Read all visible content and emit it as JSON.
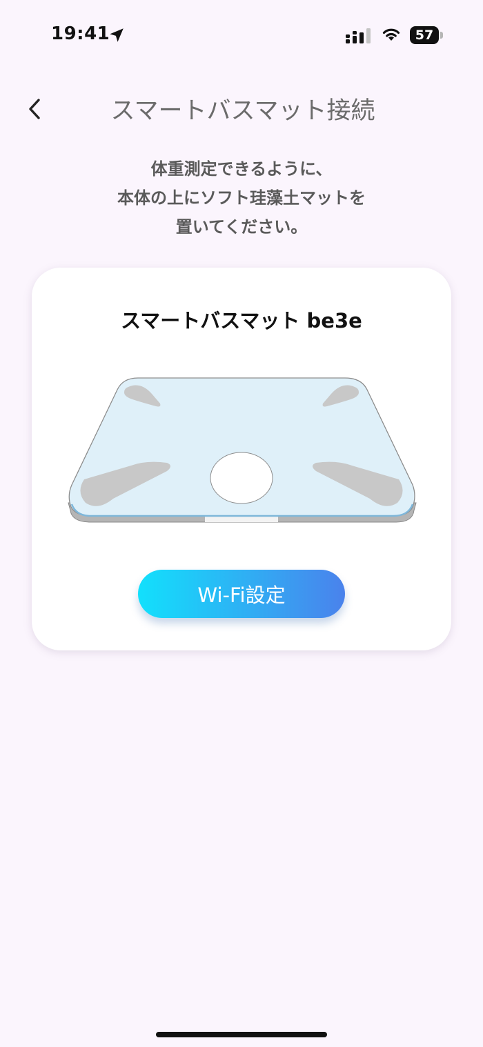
{
  "status_bar": {
    "time": "19:41",
    "battery_level": "57",
    "icons": [
      "location-arrow-icon",
      "cellular-signal-icon",
      "wifi-icon",
      "battery-icon"
    ]
  },
  "header": {
    "back_icon": "chevron-left-icon",
    "title": "スマートバスマット接続"
  },
  "instruction": {
    "line1": "体重測定できるように、",
    "line2": "本体の上にソフト珪藻土マットを",
    "line3": "置いてください。"
  },
  "card": {
    "device_name": "スマートバスマット be3e",
    "illustration": "smart-bathmat-illustration",
    "wifi_button_label": "Wi-Fi設定"
  },
  "colors": {
    "background": "#fbf5fd",
    "button_gradient_start": "#12e0fc",
    "button_gradient_end": "#4a82ec",
    "mat_surface": "#dff0f9"
  }
}
